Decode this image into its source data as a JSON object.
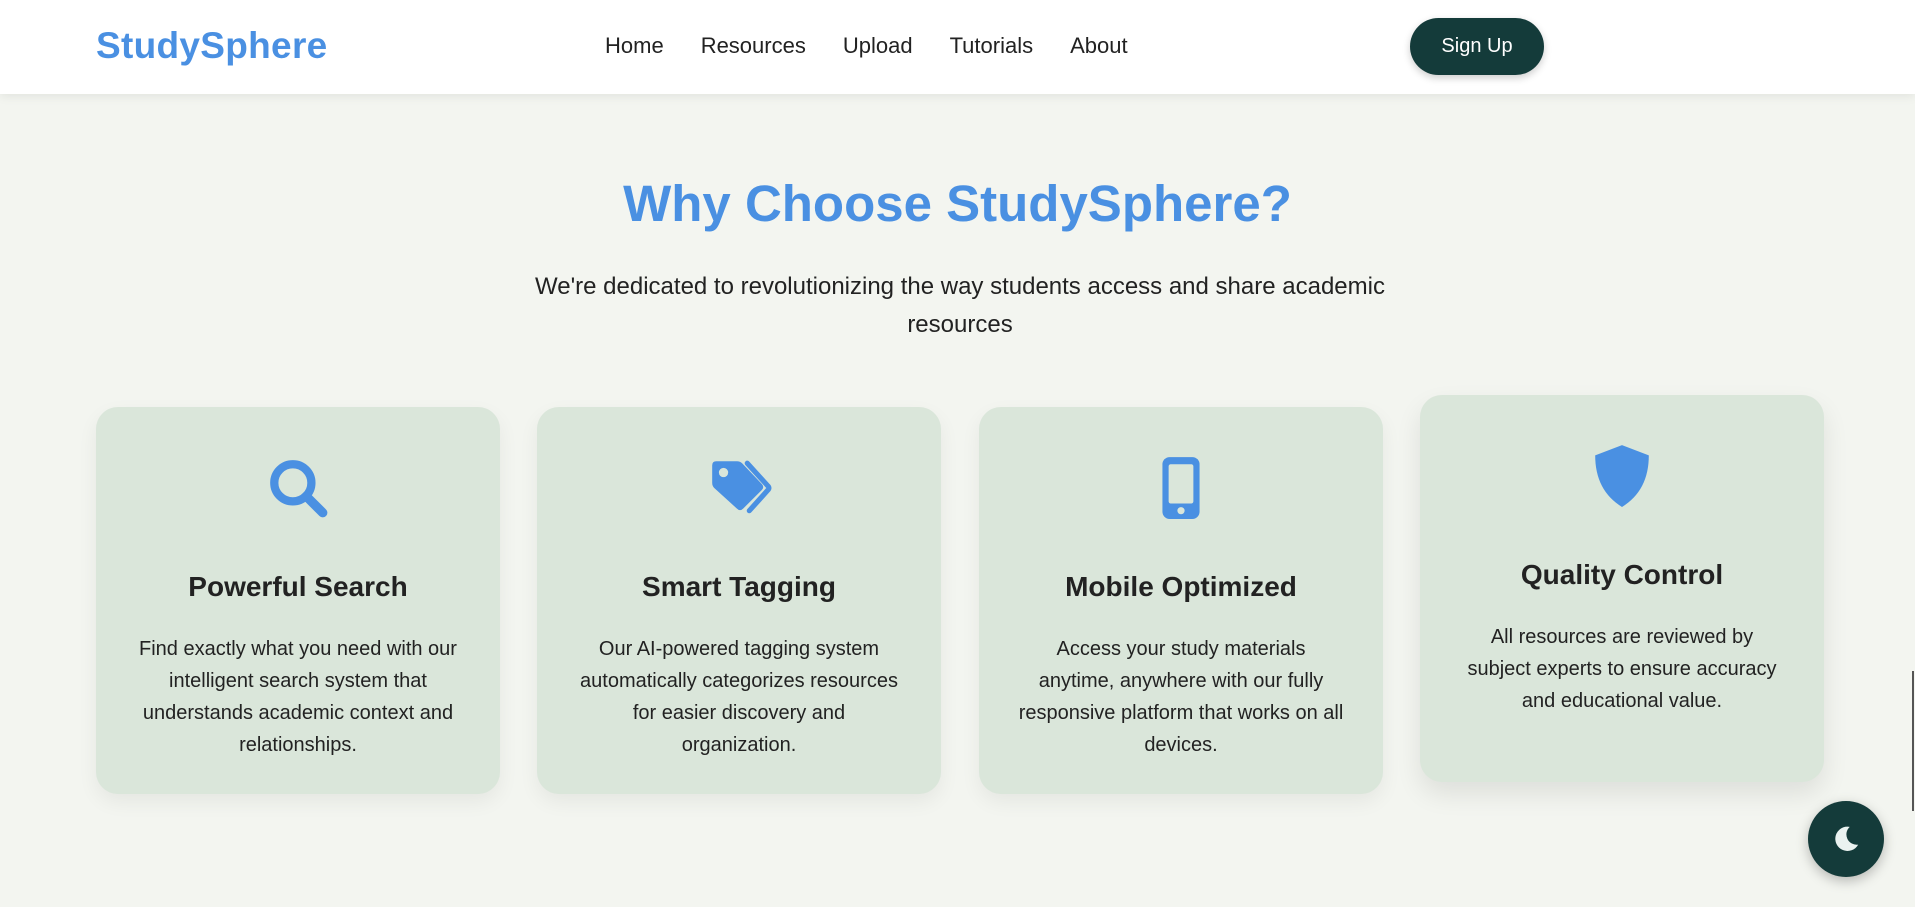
{
  "header": {
    "logo": "StudySphere",
    "nav": [
      {
        "label": "Home"
      },
      {
        "label": "Resources"
      },
      {
        "label": "Upload"
      },
      {
        "label": "Tutorials"
      },
      {
        "label": "About"
      }
    ],
    "signup_label": "Sign Up"
  },
  "hero": {
    "title": "Why Choose StudySphere?",
    "subtitle": "We're dedicated to revolutionizing the way students access and share academic resources"
  },
  "features": [
    {
      "icon": "search-icon",
      "title": "Powerful Search",
      "description": "Find exactly what you need with our intelligent search system that understands academic context and relationships."
    },
    {
      "icon": "tags-icon",
      "title": "Smart Tagging",
      "description": "Our AI-powered tagging system automatically categorizes resources for easier discovery and organization."
    },
    {
      "icon": "mobile-icon",
      "title": "Mobile Optimized",
      "description": "Access your study materials anytime, anywhere with our fully responsive platform that works on all devices."
    },
    {
      "icon": "shield-icon",
      "title": "Quality Control",
      "description": "All resources are reviewed by subject experts to ensure accuracy and educational value."
    }
  ],
  "theme_toggle": {
    "icon": "moon-icon"
  },
  "colors": {
    "accent": "#4a90e2",
    "dark": "#143b3a",
    "card_bg": "#dae6da",
    "page_bg": "#f3f5f0"
  }
}
